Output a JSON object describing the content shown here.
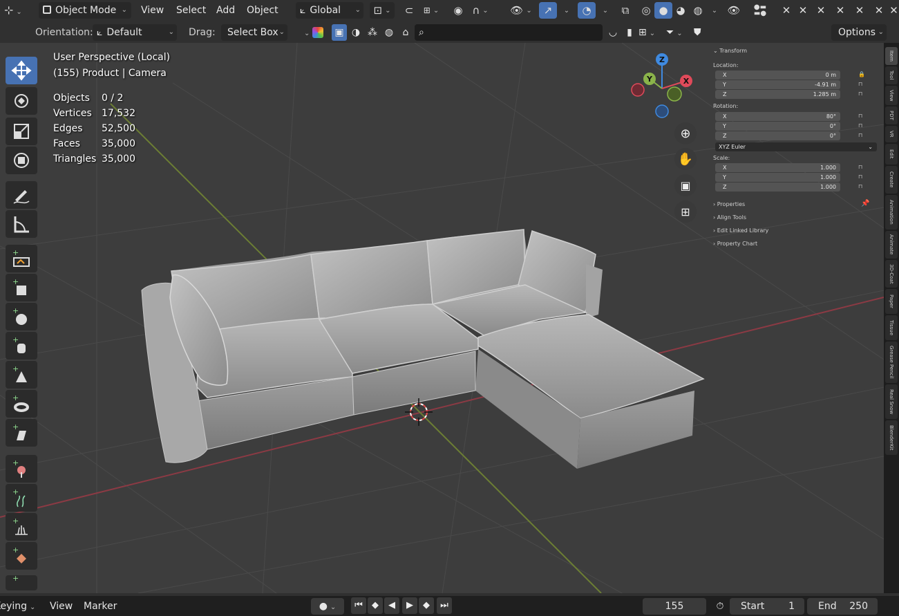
{
  "header": {
    "editor_icon": "editor-type-icon",
    "mode": "Object Mode",
    "menus": [
      "View",
      "Select",
      "Add",
      "Object"
    ],
    "transform_orientation": "Global",
    "x_glyphs": [
      "✕",
      "✕",
      "✕",
      "✕",
      "✕",
      "✕",
      "✕",
      "✕"
    ]
  },
  "tool_settings": {
    "orientation_label": "Orientation:",
    "orientation_value": "Default",
    "drag_label": "Drag:",
    "drag_value": "Select Box",
    "search_placeholder": "",
    "options": "Options"
  },
  "overlay": {
    "view_name": "User Perspective (Local)",
    "object_info": "(155) Product | Camera",
    "stats": [
      {
        "label": "Objects",
        "value": "0 / 2"
      },
      {
        "label": "Vertices",
        "value": "17,532"
      },
      {
        "label": "Edges",
        "value": "52,500"
      },
      {
        "label": "Faces",
        "value": "35,000"
      },
      {
        "label": "Triangles",
        "value": "35,000"
      }
    ]
  },
  "gizmo": {
    "x": "X",
    "y": "Y",
    "z": "Z"
  },
  "npanel": {
    "transform": "Transform",
    "location_label": "Location:",
    "location": [
      {
        "axis": "X",
        "value": "0 m"
      },
      {
        "axis": "Y",
        "value": "-4.91 m"
      },
      {
        "axis": "Z",
        "value": "1.285 m"
      }
    ],
    "rotation_label": "Rotation:",
    "rotation": [
      {
        "axis": "X",
        "value": "80°"
      },
      {
        "axis": "Y",
        "value": "0°"
      },
      {
        "axis": "Z",
        "value": "0°"
      }
    ],
    "rotation_mode": "XYZ Euler",
    "scale_label": "Scale:",
    "scale": [
      {
        "axis": "X",
        "value": "1.000"
      },
      {
        "axis": "Y",
        "value": "1.000"
      },
      {
        "axis": "Z",
        "value": "1.000"
      }
    ],
    "sections": [
      "Properties",
      "Align Tools",
      "Edit Linked Library",
      "Property Chart"
    ]
  },
  "tabs": [
    "Item",
    "Tool",
    "View",
    "PDT",
    "VR",
    "Edit",
    "Create",
    "Animation",
    "Animate",
    "3D-Coat",
    "Paper",
    "Tissue",
    "Grease Pencil",
    "Real Snow",
    "BlenderKit"
  ],
  "timeline": {
    "keying": "Keying",
    "view": "View",
    "marker": "Marker",
    "current_frame": "155",
    "start_label": "Start",
    "start_value": "1",
    "end_label": "End",
    "end_value": "250"
  },
  "colors": {
    "accent": "#4772b3",
    "x_axis": "#e04a5a",
    "y_axis": "#8ab34a",
    "z_axis": "#3f8ae0"
  }
}
